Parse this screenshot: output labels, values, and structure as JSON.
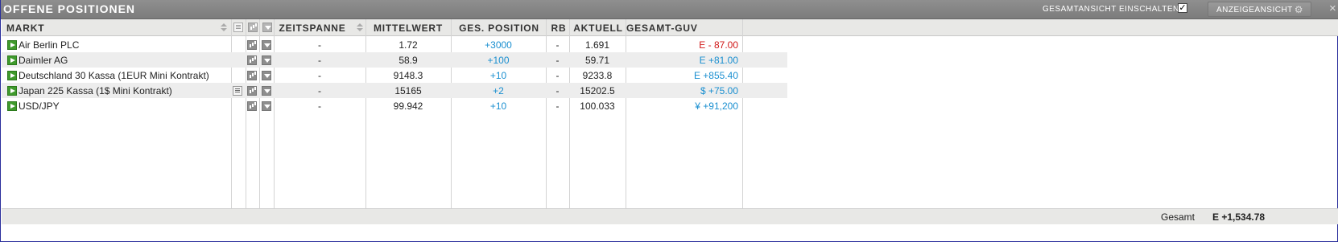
{
  "window": {
    "title": "OFFENE POSITIONEN",
    "toggle_label": "GESAMTANSICHT EINSCHALTEN",
    "toggle_checked": true,
    "toggle_mark": "✓",
    "view_button_label": "ANZEIGEANSICHT",
    "gear_glyph": "⚙",
    "close_glyph": "×"
  },
  "columns": {
    "markt": "MARKT",
    "zeitspanne": "ZEITSPANNE",
    "mittelwert": "MITTELWERT",
    "position": "GES. POSITION",
    "rb": "RB",
    "aktuell": "AKTUELL",
    "guv": "GESAMT-GUV"
  },
  "rows": [
    {
      "markt": "Air Berlin PLC",
      "note": false,
      "zeitspanne": "-",
      "mittelwert": "1.72",
      "position": "+3000",
      "rb": "-",
      "aktuell": "1.691",
      "guv": "E - 87.00",
      "guv_color": "#d01818"
    },
    {
      "markt": "Daimler AG",
      "note": false,
      "zeitspanne": "-",
      "mittelwert": "58.9",
      "position": "+100",
      "rb": "-",
      "aktuell": "59.71",
      "guv": "E +81.00",
      "guv_color": "#1a8fd0"
    },
    {
      "markt": "Deutschland 30 Kassa (1EUR Mini Kontrakt)",
      "note": false,
      "zeitspanne": "-",
      "mittelwert": "9148.3",
      "position": "+10",
      "rb": "-",
      "aktuell": "9233.8",
      "guv": "E +855.40",
      "guv_color": "#1a8fd0"
    },
    {
      "markt": "Japan 225 Kassa (1$ Mini Kontrakt)",
      "note": true,
      "zeitspanne": "-",
      "mittelwert": "15165",
      "position": "+2",
      "rb": "-",
      "aktuell": "15202.5",
      "guv": "$ +75.00",
      "guv_color": "#1a8fd0"
    },
    {
      "markt": "USD/JPY",
      "note": false,
      "zeitspanne": "-",
      "mittelwert": "99.942",
      "position": "+10",
      "rb": "-",
      "aktuell": "100.033",
      "guv": "¥ +91,200",
      "guv_color": "#1a8fd0"
    }
  ],
  "footer": {
    "label": "Gesamt",
    "value": "E +1,534.78"
  },
  "colors": {
    "frame_border": "#2a2f9c",
    "title_bar": "#858585",
    "positive": "#1a8fd0",
    "negative": "#d01818",
    "play_green": "#3f9a2c"
  }
}
